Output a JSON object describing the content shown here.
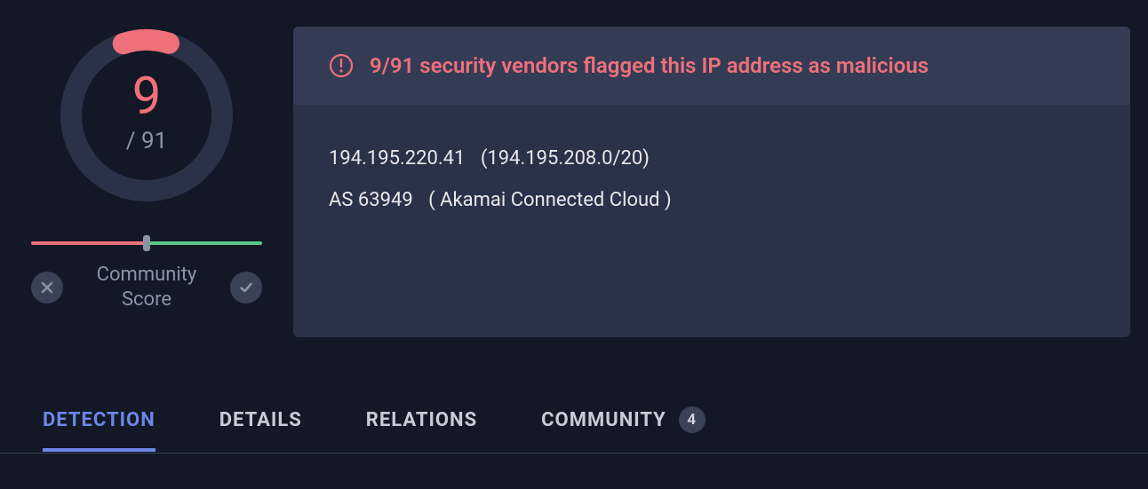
{
  "score": {
    "detected": "9",
    "total_denominator": "/ 91"
  },
  "community": {
    "label_line1": "Community",
    "label_line2": "Score"
  },
  "alert": {
    "text": "9/91 security vendors flagged this IP address as malicious"
  },
  "details": {
    "ip": "194.195.220.41",
    "cidr": "(194.195.208.0/20)",
    "asn": "AS 63949",
    "asn_name": "( Akamai Connected Cloud )"
  },
  "tabs": {
    "detection": "DETECTION",
    "details": "DETAILS",
    "relations": "RELATIONS",
    "community": "COMMUNITY",
    "community_count": "4"
  },
  "colors": {
    "accent_red": "#f0707a",
    "accent_blue": "#6e86e8",
    "panel": "#2a3249",
    "banner": "#343c55"
  }
}
